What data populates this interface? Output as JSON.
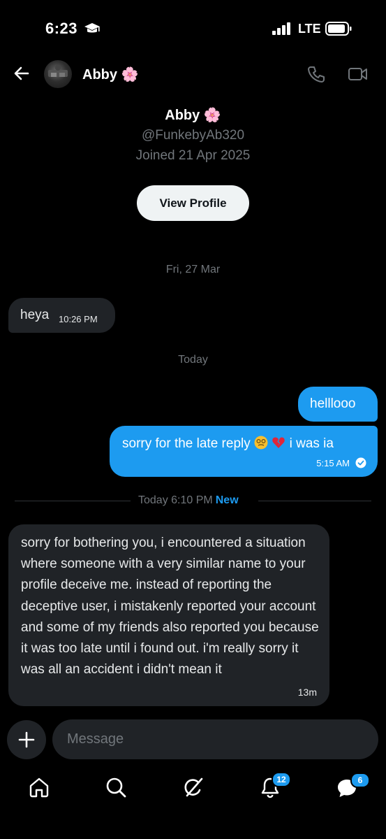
{
  "status_bar": {
    "time": "6:23",
    "network": "LTE"
  },
  "header": {
    "name": "Abby 🌸"
  },
  "profile": {
    "name": "Abby 🌸",
    "handle": "@FunkebyAb320",
    "joined": "Joined 21 Apr 2025",
    "view_profile_label": "View Profile"
  },
  "conversation": {
    "date_1": "Fri, 27 Mar",
    "msg_1": {
      "text": "heya",
      "time": "10:26 PM"
    },
    "date_2": "Today",
    "msg_2": {
      "text": "helllooo"
    },
    "msg_3": {
      "text_before": "sorry for the late reply ",
      "text_after": " i was ia",
      "time": "5:15 AM"
    },
    "divider": {
      "label": "Today 6:10 PM",
      "new_label": "New"
    },
    "msg_4": {
      "text": "sorry for bothering you, i encountered a situation where someone with a very similar name to your profile deceive me. instead of reporting the deceptive user, i mistakenly reported your account and some of my friends also reported you because it was too late until i found out. i'm really sorry it was all an accident i didn't mean it",
      "time": "13m"
    }
  },
  "composer": {
    "placeholder": "Message"
  },
  "tab_bar": {
    "notifications_badge": "12",
    "messages_badge": "6"
  },
  "colors": {
    "accent": "#1d9bf0",
    "bubble_in": "#202327",
    "background": "#000000",
    "muted": "#71767b"
  }
}
